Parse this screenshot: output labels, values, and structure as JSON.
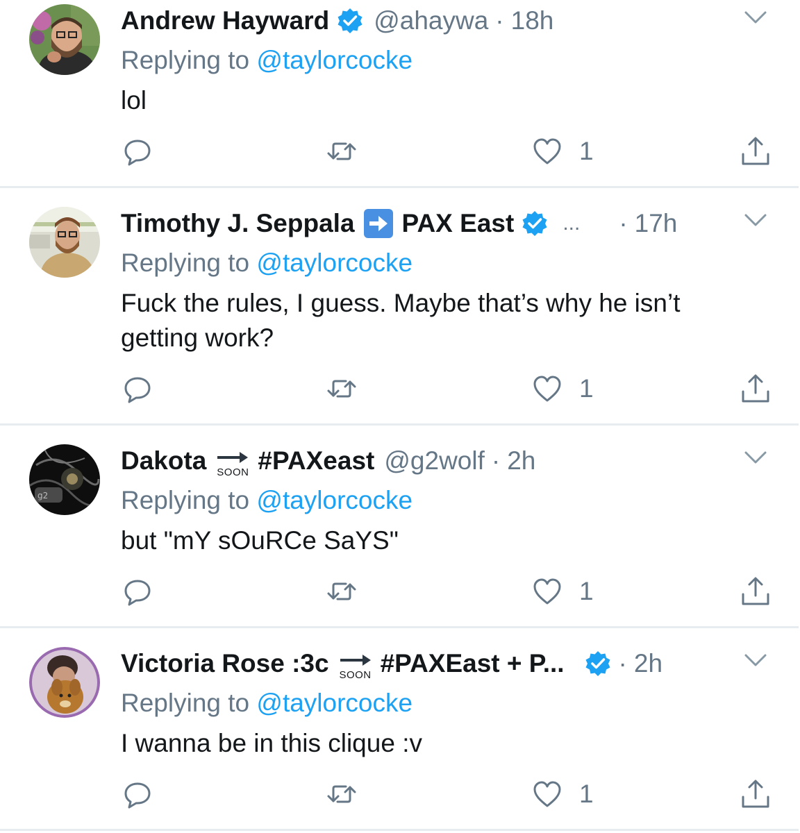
{
  "tweets": [
    {
      "name": "Andrew Hayward",
      "handle": "@ahaywa",
      "dot": "·",
      "time": "18h",
      "replying_prefix": "Replying to",
      "replying_to": "@taylorcocke",
      "text": "lol",
      "like_count": "1"
    },
    {
      "name_part1": "Timothy J. Seppala",
      "name_part2": "PAX East",
      "ellipsis": "...",
      "dot": "·",
      "time": "17h",
      "replying_prefix": "Replying to",
      "replying_to": "@taylorcocke",
      "text": "Fuck the rules, I guess. Maybe that’s why he isn’t getting work?",
      "like_count": "1"
    },
    {
      "name_part1": "Dakota",
      "soon": "SOON",
      "name_part2": "#PAXeast",
      "handle": "@g2wolf",
      "dot": "·",
      "time": "2h",
      "replying_prefix": "Replying to",
      "replying_to": "@taylorcocke",
      "text": "but \"mY sOuRCe SaYS\"",
      "like_count": "1"
    },
    {
      "name_part1": "Victoria Rose :3c",
      "soon": "SOON",
      "name_part2": "#PAXEast + P...",
      "dot": "·",
      "time": "2h",
      "replying_prefix": "Replying to",
      "replying_to": "@taylorcocke",
      "text": "I wanna be in this clique :v",
      "like_count": "1"
    }
  ],
  "icons": {
    "reply": "reply-icon",
    "retweet": "retweet-icon",
    "like": "heart-icon",
    "share": "share-icon",
    "more": "chevron-down-icon",
    "verified": "verified-badge-icon"
  },
  "colors": {
    "name": "#14171a",
    "secondary": "#657786",
    "link": "#1da1f2",
    "verified": "#1da1f2",
    "divider": "#e6ecf0"
  }
}
